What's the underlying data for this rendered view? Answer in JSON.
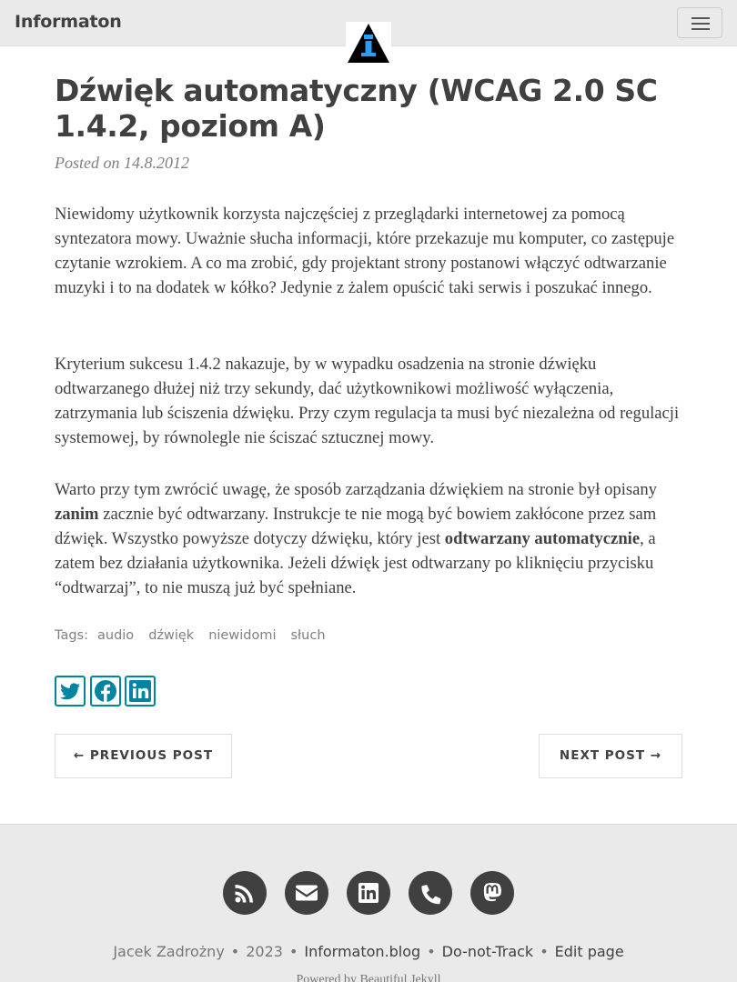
{
  "navbar": {
    "brand": "Informaton",
    "menu_icon": "hamburger-icon",
    "logo_icon": "info-triangle-logo"
  },
  "post": {
    "title": "Dźwięk automatyczny (WCAG 2.0 SC 1.4.2, poziom A)",
    "meta_prefix": "Posted on",
    "date": "14.8.2012",
    "p1": "Niewidomy użytkownik korzysta najczęściej z przeglądarki internetowej za pomocą syntezatora mowy. Uważnie słucha informacji, które przekazuje mu komputer, co zastępuje czytanie wzrokiem. A co ma zrobić, gdy projektant strony postanowi włączyć odtwarzanie muzyki i to na dodatek w kółko? Jedynie z żalem opuścić taki serwis i poszukać innego.",
    "p2": "Kryterium sukcesu 1.4.2 nakazuje, by w wypadku osadzenia na stronie dźwięku odtwarzanego dłużej niż trzy sekundy, dać użytkownikowi możliwość wyłączenia, zatrzymania lub ściszenia dźwięku. Przy czym regulacja ta musi być niezależna od regulacji systemowej, by równolegle nie ściszać sztucznej mowy.",
    "p3": {
      "a": "Warto przy tym zwrócić uwagę, że sposób zarządzania dźwiękiem na stronie był opisany ",
      "b": "zanim",
      "c": " zacznie być odtwarzany. Instrukcje te nie mogą być bowiem zakłócone przez sam dźwięk. Wszystko powyższe dotyczy dźwięku, który jest ",
      "d": "odtwarzany automatycznie",
      "e": ", a zatem bez działania użytkownika. Jeżeli dźwięk jest odtwarzany po kliknięciu przycisku “odtwarzaj”, to nie muszą już być spełniane."
    },
    "tags_label": "Tags:",
    "tags": [
      "audio",
      "dźwięk",
      "niewidomi",
      "słuch"
    ],
    "share_icons": [
      "twitter-icon",
      "facebook-icon",
      "linkedin-icon"
    ],
    "prev_label": "← PREVIOUS POST",
    "next_label": "NEXT POST →"
  },
  "footer": {
    "icons": [
      "rss-icon",
      "email-icon",
      "linkedin-icon",
      "phone-icon",
      "mastodon-icon"
    ],
    "author": "Jacek Zadrożny",
    "year": "2023",
    "site": "Informaton.blog",
    "dnt": "Do-not-Track",
    "edit": "Edit page",
    "powered": "Powered by Beautiful Jekyll"
  },
  "colors": {
    "nav_bg": "#eaeaea",
    "text": "#404040",
    "meta": "#808080",
    "share_blue": "#0085a1",
    "footer_icon_bg": "#404040",
    "logo_blue": "#2a9df4"
  }
}
